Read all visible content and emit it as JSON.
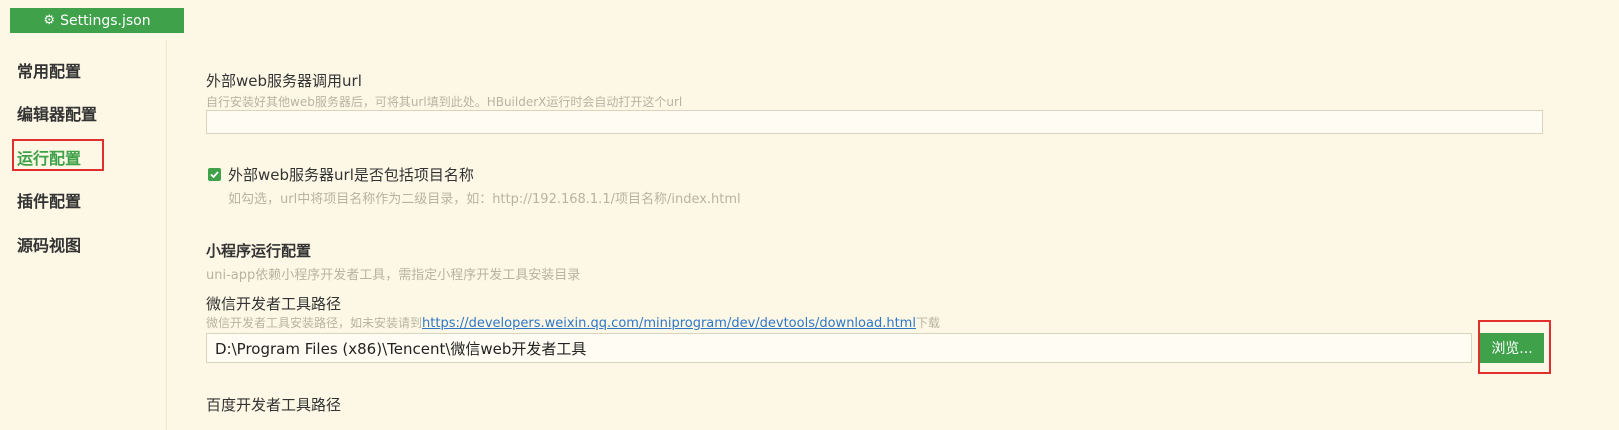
{
  "tab": {
    "icon": "gear-icon",
    "title": "Settings.json"
  },
  "sidebar": {
    "items": [
      {
        "label": "常用配置",
        "active": false
      },
      {
        "label": "编辑器配置",
        "active": false
      },
      {
        "label": "运行配置",
        "active": true
      },
      {
        "label": "插件配置",
        "active": false
      },
      {
        "label": "源码视图",
        "active": false
      }
    ]
  },
  "main": {
    "web_server_url": {
      "label": "外部web服务器调用url",
      "hint": "自行安装好其他web服务器后，可将其url填到此处。HBuilderX运行时会自动打开这个url",
      "value": ""
    },
    "include_project_name": {
      "checked": true,
      "label": "外部web服务器url是否包括项目名称",
      "hint": "如勾选，url中将项目名称作为二级目录，如：http://192.168.1.1/项目名称/index.html"
    },
    "miniprogram": {
      "section_title": "小程序运行配置",
      "section_hint": "uni-app依赖小程序开发者工具，需指定小程序开发工具安装目录"
    },
    "wechat_path": {
      "label": "微信开发者工具路径",
      "hint_prefix": "微信开发者工具安装路径，如未安装请到",
      "hint_link": "https://developers.weixin.qq.com/miniprogram/dev/devtools/download.html",
      "hint_suffix": "下载",
      "value": "D:\\Program Files (x86)\\Tencent\\微信web开发者工具",
      "browse_label": "浏览..."
    },
    "baidu_path": {
      "label": "百度开发者工具路径"
    }
  },
  "colors": {
    "accent": "#3fa24b",
    "background": "#fdf8e6",
    "highlight": "#e0302d",
    "link": "#2f76c6"
  }
}
